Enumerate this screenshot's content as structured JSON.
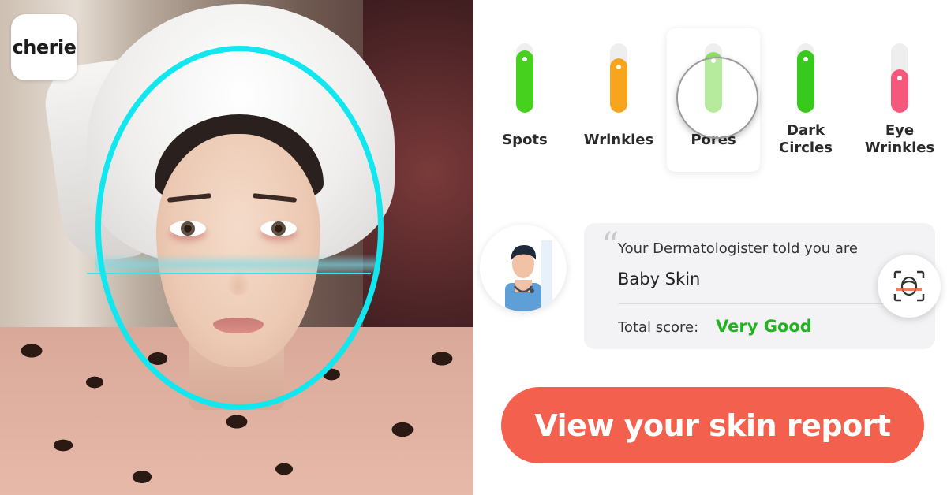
{
  "brand": {
    "logo_text": "cherie"
  },
  "metrics": [
    {
      "label": "Spots",
      "level": 0.9,
      "color": "#46d11e",
      "active": false
    },
    {
      "label": "Wrinkles",
      "level": 0.78,
      "color": "#f7a51e",
      "active": false
    },
    {
      "label": "Pores",
      "level": 0.88,
      "color": "#8fe06a",
      "active": true
    },
    {
      "label": "Dark Circles",
      "level": 0.9,
      "color": "#37c91c",
      "active": false
    },
    {
      "label": "Eye Wrinkles",
      "level": 0.62,
      "color": "#f5587a",
      "active": false
    }
  ],
  "dermatologist": {
    "intro": "Your Dermatologister told you are",
    "skin_type": "Baby Skin",
    "score_label": "Total score:",
    "score_value": "Very Good",
    "score_color": "#22b321",
    "avatar_icon": "doctor-avatar-icon",
    "scan_icon": "face-scan-icon"
  },
  "cta": {
    "label": "View your skin report",
    "color": "#f3604d"
  },
  "scan_ring_color": "#12e6ee"
}
